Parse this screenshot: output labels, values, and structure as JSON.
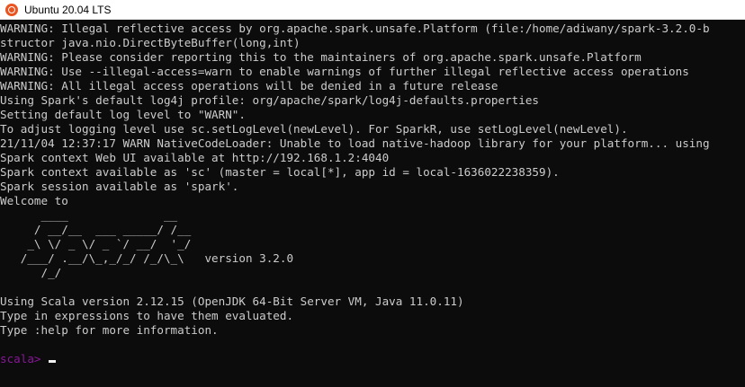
{
  "window": {
    "title": "Ubuntu 20.04 LTS",
    "icon": "ubuntu-icon"
  },
  "terminal": {
    "lines": [
      "WARNING: Illegal reflective access by org.apache.spark.unsafe.Platform (file:/home/adiwany/spark-3.2.0-b",
      "structor java.nio.DirectByteBuffer(long,int)",
      "WARNING: Please consider reporting this to the maintainers of org.apache.spark.unsafe.Platform",
      "WARNING: Use --illegal-access=warn to enable warnings of further illegal reflective access operations",
      "WARNING: All illegal access operations will be denied in a future release",
      "Using Spark's default log4j profile: org/apache/spark/log4j-defaults.properties",
      "Setting default log level to \"WARN\".",
      "To adjust logging level use sc.setLogLevel(newLevel). For SparkR, use setLogLevel(newLevel).",
      "21/11/04 12:37:17 WARN NativeCodeLoader: Unable to load native-hadoop library for your platform... using",
      "Spark context Web UI available at http://192.168.1.2:4040",
      "Spark context available as 'sc' (master = local[*], app id = local-1636022238359).",
      "Spark session available as 'spark'.",
      "Welcome to",
      "      ____              __",
      "     / __/__  ___ _____/ /__",
      "    _\\ \\/ _ \\/ _ `/ __/  '_/",
      "   /___/ .__/\\_,_/_/ /_/\\_\\   version 3.2.0",
      "      /_/",
      "",
      "Using Scala version 2.12.15 (OpenJDK 64-Bit Server VM, Java 11.0.11)",
      "Type in expressions to have them evaluated.",
      "Type :help for more information.",
      ""
    ],
    "prompt": "scala>",
    "input_value": ""
  },
  "colors": {
    "background": "#0c0c0c",
    "text": "#cccccc",
    "prompt": "#881798",
    "title_bar": "#ffffff"
  }
}
